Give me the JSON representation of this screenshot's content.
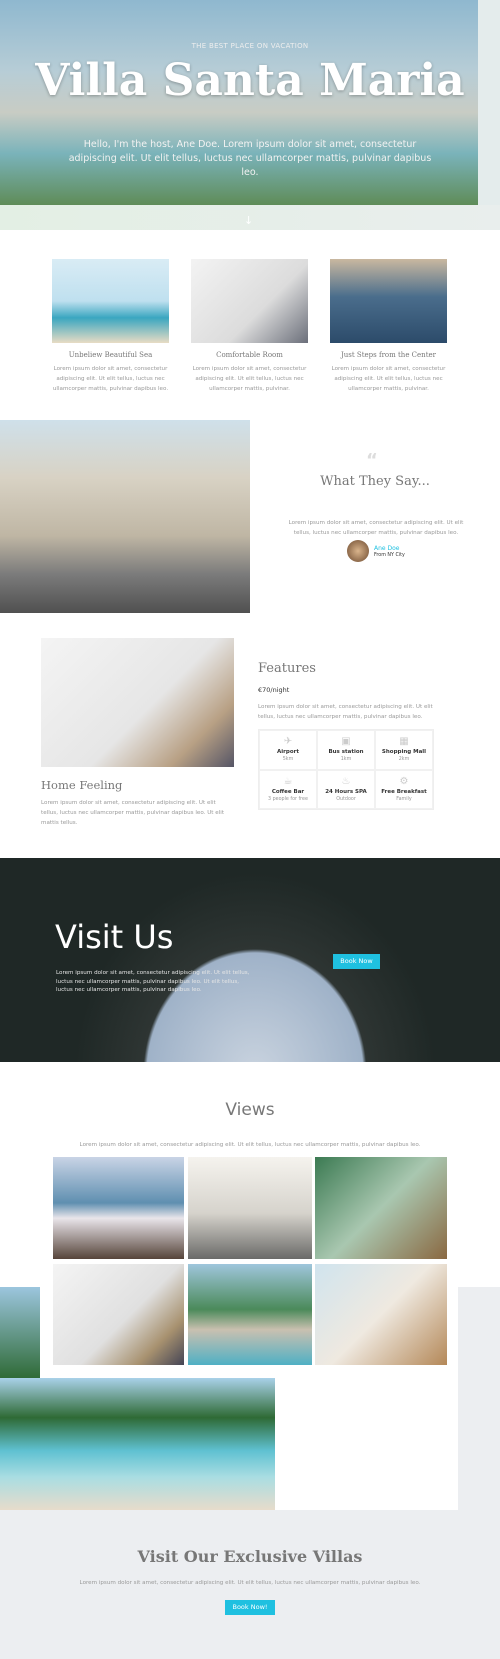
{
  "hero": {
    "eyebrow": "THE BEST PLACE ON VACATION",
    "title": "Villa Santa Maria",
    "text": "Hello, I'm the host, Ane Doe. Lorem ipsum dolor sit amet, consectetur adipiscing elit. Ut elit tellus, luctus nec ullamcorper mattis, pulvinar dapibus leo.",
    "arrow_icon": "arrow-down-icon"
  },
  "cards": [
    {
      "title": "Unbeliew Beautiful Sea",
      "text": "Lorem ipsum dolor sit amet, consectetur adipiscing elit. Ut elit tellus, luctus nec ullamcorper mattis, pulvinar dapibus leo."
    },
    {
      "title": "Comfortable Room",
      "text": "Lorem ipsum dolor sit amet, consectetur adipiscing elit. Ut elit tellus, luctus nec ullamcorper mattis, pulvinar."
    },
    {
      "title": "Just Steps from the Center",
      "text": "Lorem ipsum dolor sit amet, consectetur adipiscing elit. Ut elit tellus, luctus nec ullamcorper mattis, pulvinar."
    }
  ],
  "testimonial": {
    "heading": "What They Say...",
    "text": "Lorem ipsum dolor sit amet, consectetur adipiscing elit. Ut elit tellus, luctus nec ullamcorper mattis, pulvinar dapibus leo.",
    "name": "Ane Doe",
    "location": "From NY City"
  },
  "features": {
    "heading": "Features",
    "price": "€70/night",
    "text": "Lorem ipsum dolor sit amet, consectetur adipiscing elit. Ut elit tellus, luctus nec ullamcorper mattis, pulvinar dapibus leo.",
    "items": [
      {
        "icon": "airplane-icon",
        "name": "Airport",
        "sub": "5km"
      },
      {
        "icon": "bus-icon",
        "name": "Bus station",
        "sub": "1km"
      },
      {
        "icon": "shopping-icon",
        "name": "Shopping Mall",
        "sub": "2km"
      },
      {
        "icon": "coffee-icon",
        "name": "Coffee Bar",
        "sub": "3 people for free"
      },
      {
        "icon": "bath-icon",
        "name": "24 Hours SPA",
        "sub": "Outdoor"
      },
      {
        "icon": "cutlery-icon",
        "name": "Free Breakfast",
        "sub": "Family"
      }
    ]
  },
  "home": {
    "heading": "Home Feeling",
    "text": "Lorem ipsum dolor sit amet, consectetur adipiscing elit. Ut elit tellus, luctus nec ullamcorper mattis, pulvinar dapibus leo. Ut elit mattis tellus."
  },
  "visit": {
    "heading": "Visit Us",
    "text": "Lorem ipsum dolor sit amet, consectetur adipiscing elit. Ut elit tellus, luctus nec ullamcorper mattis, pulvinar dapibus leo. Ut elit tellus, luctus nec ullamcorper mattis, pulvinar dapibus leo.",
    "button": "Book Now"
  },
  "views": {
    "heading": "Views",
    "text": "Lorem ipsum dolor sit amet, consectetur adipiscing elit. Ut elit tellus, luctus nec ullamcorper mattis, pulvinar dapibus leo."
  },
  "cta": {
    "heading": "Visit Our Exclusive Villas",
    "text": "Lorem ipsum dolor sit amet, consectetur adipiscing elit. Ut elit tellus, luctus nec ullamcorper mattis, pulvinar dapibus leo.",
    "button": "Book Now!"
  },
  "colors": {
    "accent": "#1fc0e0",
    "footer_bg": "#eceef1"
  }
}
